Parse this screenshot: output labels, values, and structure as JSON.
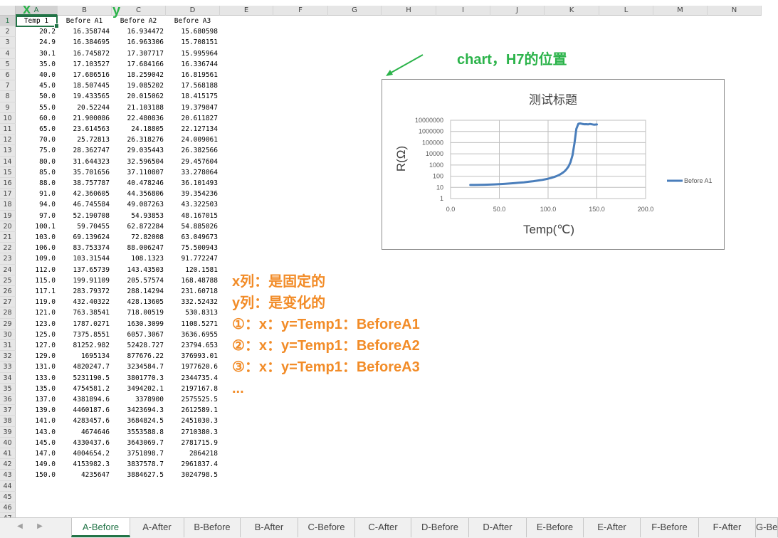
{
  "columns": [
    "A",
    "B",
    "C",
    "D",
    "E",
    "F",
    "G",
    "H",
    "I",
    "J",
    "K",
    "L",
    "M",
    "N"
  ],
  "headers": [
    "Temp 1",
    "Before A1",
    "Before A2",
    "Before A3"
  ],
  "rows": [
    [
      "20.2",
      "16.358744",
      "16.934472",
      "15.680598"
    ],
    [
      "24.9",
      "16.384695",
      "16.963306",
      "15.708151"
    ],
    [
      "30.1",
      "16.745872",
      "17.307717",
      "15.995964"
    ],
    [
      "35.0",
      "17.103527",
      "17.684166",
      "16.336744"
    ],
    [
      "40.0",
      "17.686516",
      "18.259042",
      "16.819561"
    ],
    [
      "45.0",
      "18.507445",
      "19.085202",
      "17.568188"
    ],
    [
      "50.0",
      "19.433565",
      "20.015062",
      "18.415175"
    ],
    [
      "55.0",
      "20.52244",
      "21.103188",
      "19.379847"
    ],
    [
      "60.0",
      "21.900086",
      "22.480836",
      "20.611827"
    ],
    [
      "65.0",
      "23.614563",
      "24.18805",
      "22.127134"
    ],
    [
      "70.0",
      "25.72813",
      "26.318276",
      "24.009061"
    ],
    [
      "75.0",
      "28.362747",
      "29.035443",
      "26.382566"
    ],
    [
      "80.0",
      "31.644323",
      "32.596504",
      "29.457604"
    ],
    [
      "85.0",
      "35.701656",
      "37.110807",
      "33.278064"
    ],
    [
      "88.0",
      "38.757787",
      "40.478246",
      "36.101493"
    ],
    [
      "91.0",
      "42.360605",
      "44.356806",
      "39.354236"
    ],
    [
      "94.0",
      "46.745584",
      "49.087263",
      "43.322503"
    ],
    [
      "97.0",
      "52.190708",
      "54.93853",
      "48.167015"
    ],
    [
      "100.1",
      "59.70455",
      "62.872284",
      "54.885026"
    ],
    [
      "103.0",
      "69.139624",
      "72.82008",
      "63.049673"
    ],
    [
      "106.0",
      "83.753374",
      "88.006247",
      "75.500943"
    ],
    [
      "109.0",
      "103.31544",
      "108.1323",
      "91.772247"
    ],
    [
      "112.0",
      "137.65739",
      "143.43503",
      "120.1581"
    ],
    [
      "115.0",
      "199.91109",
      "205.57574",
      "168.48788"
    ],
    [
      "117.1",
      "283.79372",
      "288.14294",
      "231.60718"
    ],
    [
      "119.0",
      "432.40322",
      "428.13605",
      "332.52432"
    ],
    [
      "121.0",
      "763.38541",
      "718.00519",
      "530.8313"
    ],
    [
      "123.0",
      "1787.0271",
      "1630.3099",
      "1108.5271"
    ],
    [
      "125.0",
      "7375.8551",
      "6057.3067",
      "3636.6955"
    ],
    [
      "127.0",
      "81252.982",
      "52428.727",
      "23794.653"
    ],
    [
      "129.0",
      "1695134",
      "877676.22",
      "376993.01"
    ],
    [
      "131.0",
      "4820247.7",
      "3234584.7",
      "1977620.6"
    ],
    [
      "133.0",
      "5231190.5",
      "3801770.3",
      "2344735.4"
    ],
    [
      "135.0",
      "4754581.2",
      "3494202.1",
      "2197167.8"
    ],
    [
      "137.0",
      "4381894.6",
      "3378900",
      "2575525.5"
    ],
    [
      "139.0",
      "4460187.6",
      "3423694.3",
      "2612589.1"
    ],
    [
      "141.0",
      "4283457.6",
      "3684824.5",
      "2451030.3"
    ],
    [
      "143.0",
      "4674646",
      "3553588.8",
      "2710380.3"
    ],
    [
      "145.0",
      "4330437.6",
      "3643069.7",
      "2781715.9"
    ],
    [
      "147.0",
      "4004654.2",
      "3751898.7",
      "2864218"
    ],
    [
      "149.0",
      "4153982.3",
      "3837578.7",
      "2961837.4"
    ],
    [
      "150.0",
      "4235647",
      "3884627.5",
      "3024798.5"
    ]
  ],
  "annotations": {
    "x_marker": "x",
    "y_marker": "y",
    "chart_note": "chart，H7的位置",
    "lines": [
      "x列：是固定的",
      "y列：是变化的",
      "①：x：y=Temp1：BeforeA1",
      "②：x：y=Temp1：BeforeA2",
      "③：x：y=Temp1：BeforeA3",
      "..."
    ]
  },
  "colors": {
    "green": "#2bb34a",
    "orange": "#f28c28",
    "series": "#4a7ebb",
    "excel_green": "#217346"
  },
  "tabs": [
    "A-Before",
    "A-After",
    "B-Before",
    "B-After",
    "C-Before",
    "C-After",
    "D-Before",
    "D-After",
    "E-Before",
    "E-After",
    "F-Before",
    "F-After",
    "G-Before"
  ],
  "active_tab": "A-Before",
  "chart_data": {
    "type": "scatter",
    "title": "测试标题",
    "xlabel": "Temp(℃)",
    "ylabel": "R(Ω)",
    "xlim": [
      0,
      200
    ],
    "ylim": [
      1,
      10000000
    ],
    "y_scale": "log",
    "x_ticks": [
      "0.0",
      "50.0",
      "100.0",
      "150.0",
      "200.0"
    ],
    "y_ticks": [
      "1",
      "10",
      "100",
      "1000",
      "10000",
      "100000",
      "1000000",
      "10000000"
    ],
    "grid": true,
    "legend": "right",
    "series": [
      {
        "name": "Before A1",
        "x": [
          20.2,
          24.9,
          30.1,
          35.0,
          40.0,
          45.0,
          50.0,
          55.0,
          60.0,
          65.0,
          70.0,
          75.0,
          80.0,
          85.0,
          88.0,
          91.0,
          94.0,
          97.0,
          100.1,
          103.0,
          106.0,
          109.0,
          112.0,
          115.0,
          117.1,
          119.0,
          121.0,
          123.0,
          125.0,
          127.0,
          129.0,
          131.0,
          133.0,
          135.0,
          137.0,
          139.0,
          141.0,
          143.0,
          145.0,
          147.0,
          149.0,
          150.0
        ],
        "y": [
          16.358744,
          16.384695,
          16.745872,
          17.103527,
          17.686516,
          18.507445,
          19.433565,
          20.52244,
          21.900086,
          23.614563,
          25.72813,
          28.362747,
          31.644323,
          35.701656,
          38.757787,
          42.360605,
          46.745584,
          52.190708,
          59.70455,
          69.139624,
          83.753374,
          103.31544,
          137.65739,
          199.91109,
          283.79372,
          432.40322,
          763.38541,
          1787.0271,
          7375.8551,
          81252.982,
          1695134,
          4820247.7,
          5231190.5,
          4754581.2,
          4381894.6,
          4460187.6,
          4283457.6,
          4674646,
          4330437.6,
          4004654.2,
          4153982.3,
          4235647
        ]
      }
    ]
  }
}
